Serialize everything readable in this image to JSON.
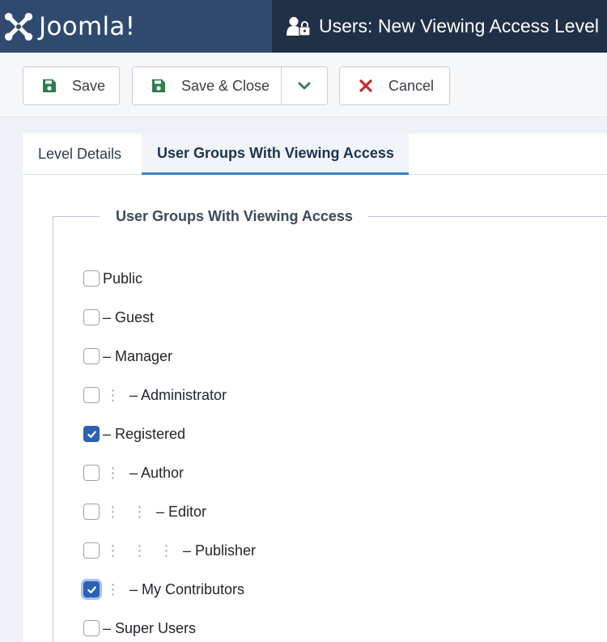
{
  "header": {
    "brand_name": "Joomla!",
    "page_title": "Users: New Viewing Access Level"
  },
  "toolbar": {
    "save_label": "Save",
    "save_close_label": "Save & Close",
    "cancel_label": "Cancel"
  },
  "tabs": [
    {
      "label": "Level Details",
      "active": false
    },
    {
      "label": "User Groups With Viewing Access",
      "active": true
    }
  ],
  "fieldset": {
    "legend": "User Groups With Viewing Access"
  },
  "groups": [
    {
      "label": "Public",
      "depth": 0,
      "checked": false
    },
    {
      "label": "– Guest",
      "depth": 0,
      "checked": false
    },
    {
      "label": "– Manager",
      "depth": 0,
      "checked": false
    },
    {
      "label": "– Administrator",
      "depth": 1,
      "checked": false
    },
    {
      "label": "– Registered",
      "depth": 0,
      "checked": true
    },
    {
      "label": "– Author",
      "depth": 1,
      "checked": false
    },
    {
      "label": "– Editor",
      "depth": 2,
      "checked": false
    },
    {
      "label": "– Publisher",
      "depth": 3,
      "checked": false
    },
    {
      "label": "– My Contributors",
      "depth": 1,
      "checked": true,
      "focused": true
    },
    {
      "label": "– Super Users",
      "depth": 0,
      "checked": false
    }
  ],
  "colors": {
    "brand_bg": "#2f4a6e",
    "title_bg": "#1f3047",
    "save_icon": "#2f7d4f",
    "cancel_icon": "#c52a2a",
    "checkbox_checked": "#2a62b5",
    "tab_active_border": "#3f7ec6"
  },
  "icons": {
    "brand": "joomla-logo-icon",
    "title": "users-lock-icon",
    "save": "floppy-disk-icon",
    "dropdown": "chevron-down-icon",
    "cancel": "close-icon",
    "checkbox": "check-icon"
  }
}
